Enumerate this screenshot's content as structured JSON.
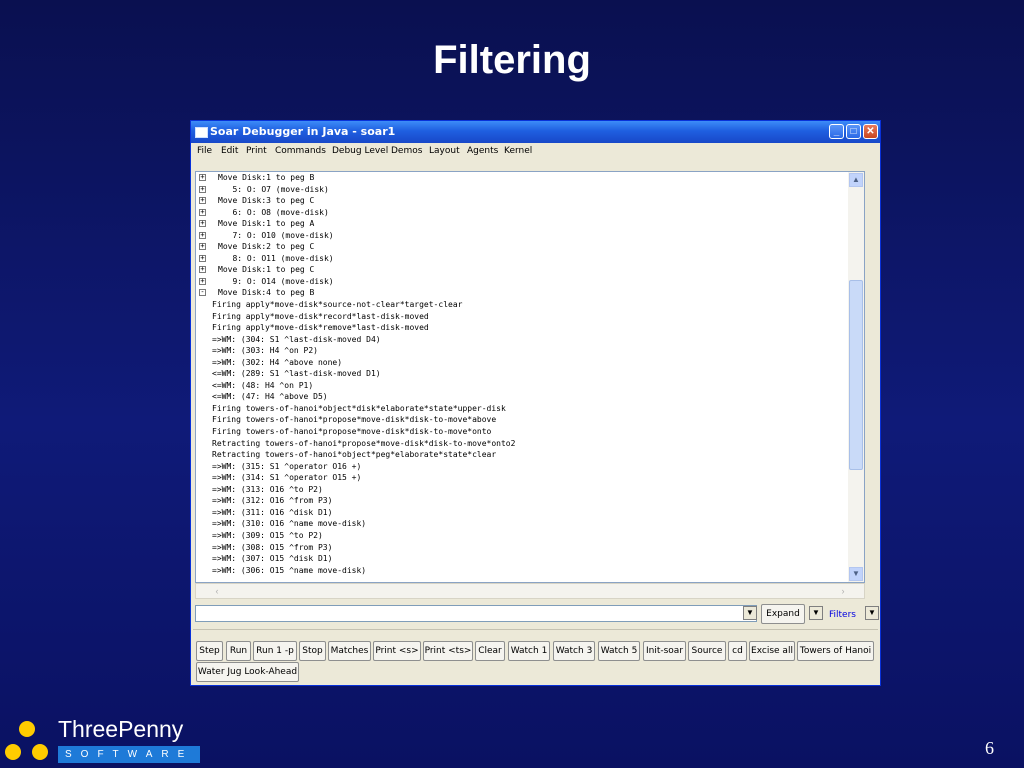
{
  "slide": {
    "title": "Filtering",
    "page_number": "6",
    "logo": {
      "name": "ThreePenny",
      "tagline": "SOFTWARE"
    }
  },
  "window": {
    "title": "Soar Debugger in Java - soar1",
    "menu": [
      "File",
      "Edit",
      "Print",
      "Commands",
      "Debug Level",
      "Demos",
      "Layout",
      "Agents",
      "Kernel"
    ]
  },
  "output": {
    "lines": [
      {
        "expander": "+",
        "text": "Move Disk:1 to peg B"
      },
      {
        "expander": "+",
        "text": "   5: O: O7 (move-disk)"
      },
      {
        "expander": "+",
        "text": "Move Disk:3 to peg C"
      },
      {
        "expander": "+",
        "text": "   6: O: O8 (move-disk)"
      },
      {
        "expander": "+",
        "text": "Move Disk:1 to peg A"
      },
      {
        "expander": "+",
        "text": "   7: O: O10 (move-disk)"
      },
      {
        "expander": "+",
        "text": "Move Disk:2 to peg C"
      },
      {
        "expander": "+",
        "text": "   8: O: O11 (move-disk)"
      },
      {
        "expander": "+",
        "text": "Move Disk:1 to peg C"
      },
      {
        "expander": "+",
        "text": "   9: O: O14 (move-disk)"
      },
      {
        "expander": "-",
        "text": "Move Disk:4 to peg B"
      },
      {
        "expander": "",
        "text": "Firing apply*move-disk*source-not-clear*target-clear"
      },
      {
        "expander": "",
        "text": "Firing apply*move-disk*record*last-disk-moved"
      },
      {
        "expander": "",
        "text": "Firing apply*move-disk*remove*last-disk-moved"
      },
      {
        "expander": "",
        "text": "=>WM: (304: S1 ^last-disk-moved D4)"
      },
      {
        "expander": "",
        "text": "=>WM: (303: H4 ^on P2)"
      },
      {
        "expander": "",
        "text": "=>WM: (302: H4 ^above none)"
      },
      {
        "expander": "",
        "text": "<=WM: (289: S1 ^last-disk-moved D1)"
      },
      {
        "expander": "",
        "text": "<=WM: (48: H4 ^on P1)"
      },
      {
        "expander": "",
        "text": "<=WM: (47: H4 ^above D5)"
      },
      {
        "expander": "",
        "text": "Firing towers-of-hanoi*object*disk*elaborate*state*upper-disk"
      },
      {
        "expander": "",
        "text": "Firing towers-of-hanoi*propose*move-disk*disk-to-move*above"
      },
      {
        "expander": "",
        "text": "Firing towers-of-hanoi*propose*move-disk*disk-to-move*onto"
      },
      {
        "expander": "",
        "text": "Retracting towers-of-hanoi*propose*move-disk*disk-to-move*onto2"
      },
      {
        "expander": "",
        "text": "Retracting towers-of-hanoi*object*peg*elaborate*state*clear"
      },
      {
        "expander": "",
        "text": "=>WM: (315: S1 ^operator O16 +)"
      },
      {
        "expander": "",
        "text": "=>WM: (314: S1 ^operator O15 +)"
      },
      {
        "expander": "",
        "text": "=>WM: (313: O16 ^to P2)"
      },
      {
        "expander": "",
        "text": "=>WM: (312: O16 ^from P3)"
      },
      {
        "expander": "",
        "text": "=>WM: (311: O16 ^disk D1)"
      },
      {
        "expander": "",
        "text": "=>WM: (310: O16 ^name move-disk)"
      },
      {
        "expander": "",
        "text": "=>WM: (309: O15 ^to P2)"
      },
      {
        "expander": "",
        "text": "=>WM: (308: O15 ^from P3)"
      },
      {
        "expander": "",
        "text": "=>WM: (307: O15 ^disk D1)"
      },
      {
        "expander": "",
        "text": "=>WM: (306: O15 ^name move-disk)"
      }
    ]
  },
  "command_bar": {
    "input_value": "",
    "expand_label": "Expand",
    "filters_label": "Filters"
  },
  "buttons": [
    "Step",
    "Run",
    "Run 1 -p",
    "Stop",
    "Matches",
    "Print <s>",
    "Print <ts>",
    "Clear",
    "Watch 1",
    "Watch 3",
    "Watch 5",
    "Init-soar",
    "Source",
    "cd",
    "Excise all",
    "Towers of Hanoi",
    "Water Jug Look-Ahead"
  ],
  "colors": {
    "titlebar": "#1f5fe0",
    "slide_background": "#0f1a78",
    "logo_yellow": "#ffcc00",
    "logo_blue": "#1e7ad8"
  },
  "icons": {
    "expanded": "minus-box-icon",
    "collapsed": "plus-box-icon"
  }
}
